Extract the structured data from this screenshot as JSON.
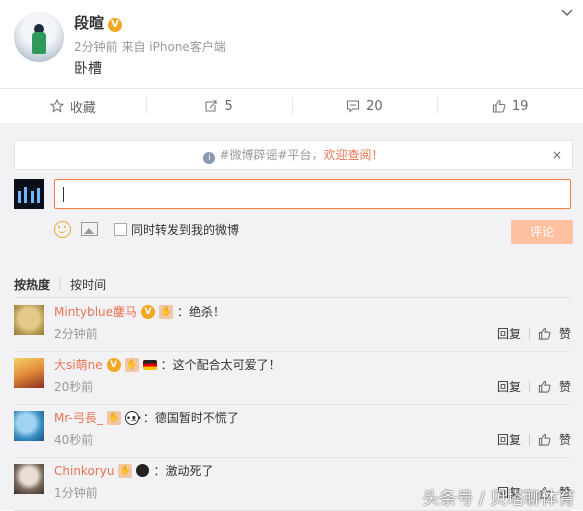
{
  "post": {
    "username": "段暄",
    "verified_mark": "V",
    "meta": "2分钟前 来自 iPhone客户端",
    "text": "卧槽"
  },
  "actions": {
    "favorite_label": "收藏",
    "repost_count": "5",
    "comment_count": "20",
    "like_count": "19"
  },
  "notice": {
    "prefix": "#微博辟谣#平台，",
    "link": "欢迎查阅！",
    "close": "×"
  },
  "compose": {
    "checkbox_label": "同时转发到我的微博",
    "submit_label": "评论"
  },
  "sort": {
    "hot": "按热度",
    "time": "按时间"
  },
  "comments": [
    {
      "name": "Mintyblue鏖马",
      "text": "：绝杀！",
      "time": "2分钟前",
      "reply": "回复",
      "like": "赞"
    },
    {
      "name": "大si萌ne",
      "text": "：这个配合太可爱了！",
      "time": "20秒前",
      "reply": "回复",
      "like": "赞"
    },
    {
      "name": "Mr-弓長_",
      "text": "：德国暂时不慌了",
      "time": "40秒前",
      "reply": "回复",
      "like": "赞"
    },
    {
      "name": "Chinkoryu",
      "text": "：激动死了",
      "time": "1分钟前",
      "reply": "回复",
      "like": "赞"
    }
  ],
  "watermark": "头条号 / 贝塔聊体育",
  "colors": {
    "accent": "#eb7350",
    "verified": "#f5a623",
    "submit_disabled": "#ffc09f"
  },
  "icons": [
    "star-icon",
    "repost-icon",
    "comment-icon",
    "like-icon",
    "emoji-icon",
    "image-icon",
    "chevron-down-icon",
    "info-icon",
    "close-icon"
  ]
}
